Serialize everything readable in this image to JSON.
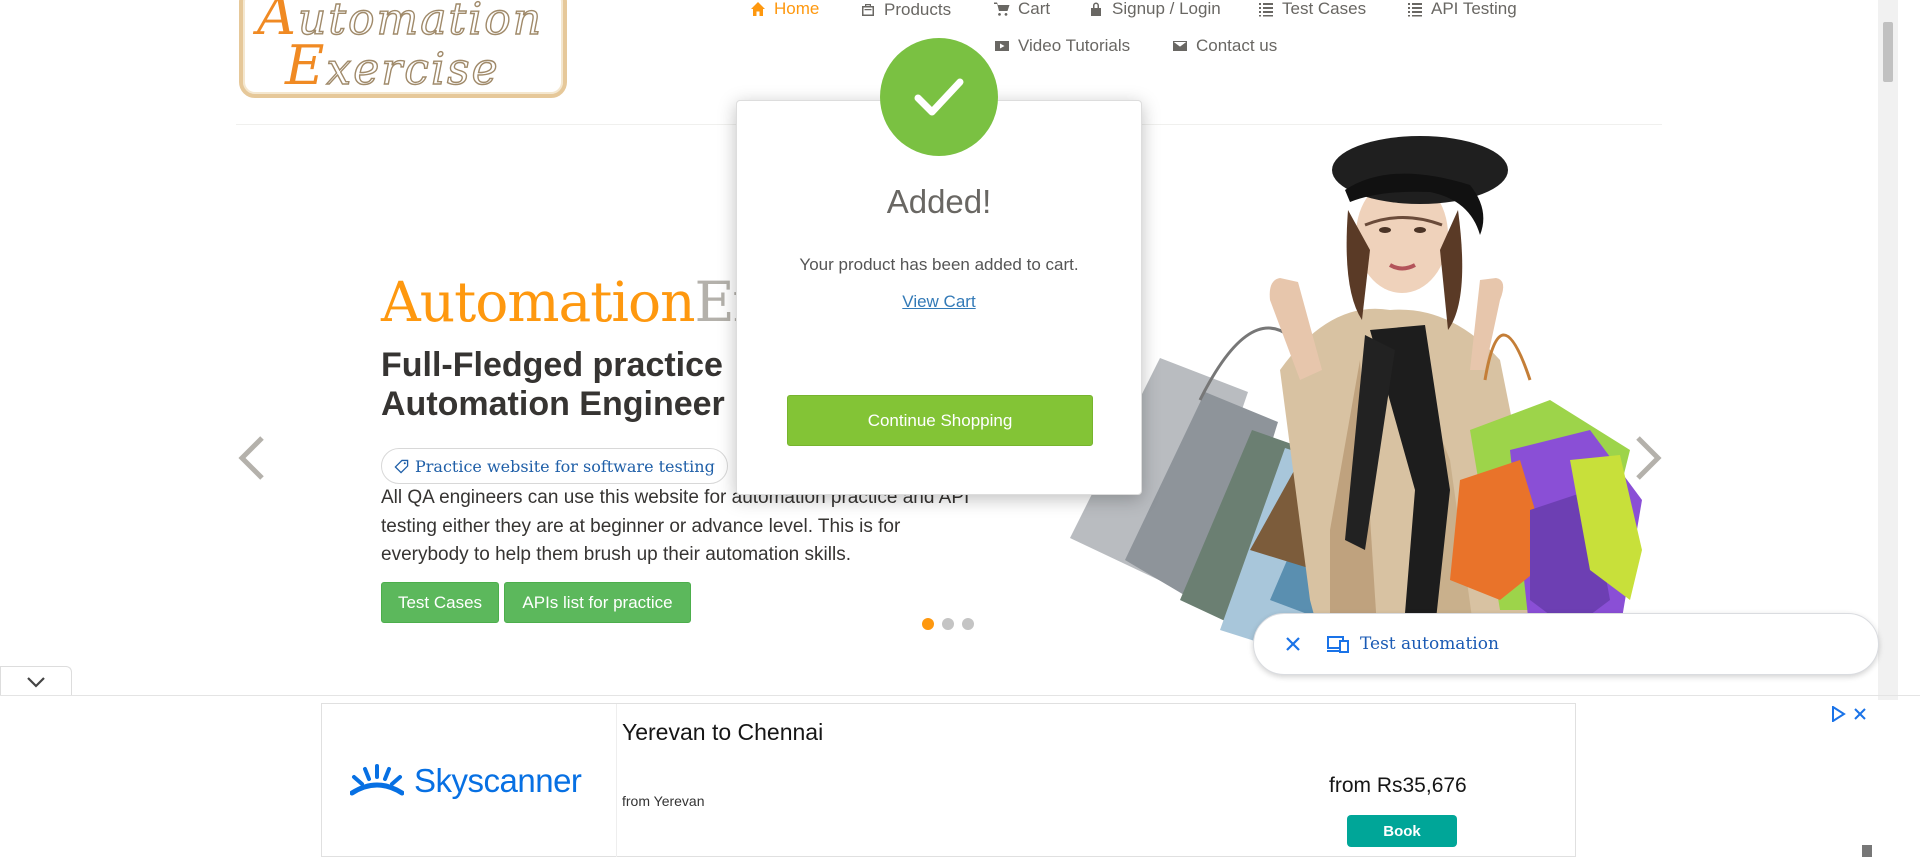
{
  "logo": {
    "line1_cap": "A",
    "line1_rest": "utomation",
    "line2_cap": "E",
    "line2_rest": "xercise"
  },
  "nav": {
    "items": [
      {
        "label": "Home",
        "icon": "home-icon"
      },
      {
        "label": "Products",
        "icon": "products-icon"
      },
      {
        "label": "Cart",
        "icon": "cart-icon"
      },
      {
        "label": "Signup / Login",
        "icon": "lock-icon"
      },
      {
        "label": "Test Cases",
        "icon": "list-icon"
      },
      {
        "label": "API Testing",
        "icon": "list-icon"
      },
      {
        "label": "Video Tutorials",
        "icon": "youtube-icon"
      },
      {
        "label": "Contact us",
        "icon": "envelope-icon"
      }
    ],
    "active_color": "#fe980f"
  },
  "slider": {
    "brand_part1": "Automation",
    "brand_part2": "Ex",
    "heading_line1": "Full-Fledged practice",
    "heading_line2": "Automation Engineer",
    "badge": "Practice website for software testing",
    "text": "All QA engineers can use this website for automation practice and API testing either they are at beginner or advance level. This is for everybody to help them brush up their automation skills.",
    "btn_test_cases": "Test Cases",
    "btn_apis": "APIs list for practice",
    "active_slide": 1,
    "slide_count": 3
  },
  "modal": {
    "title": "Added!",
    "body": "Your product has been added to cart.",
    "link": "View Cart",
    "continue": "Continue Shopping",
    "check_color": "#7ac142"
  },
  "search_chip": {
    "text": "Test automation"
  },
  "ad": {
    "brand": "Skyscanner",
    "title": "Yerevan to Chennai",
    "subtitle": "from Yerevan",
    "price": "from Rs35,676",
    "cta": "Book"
  }
}
